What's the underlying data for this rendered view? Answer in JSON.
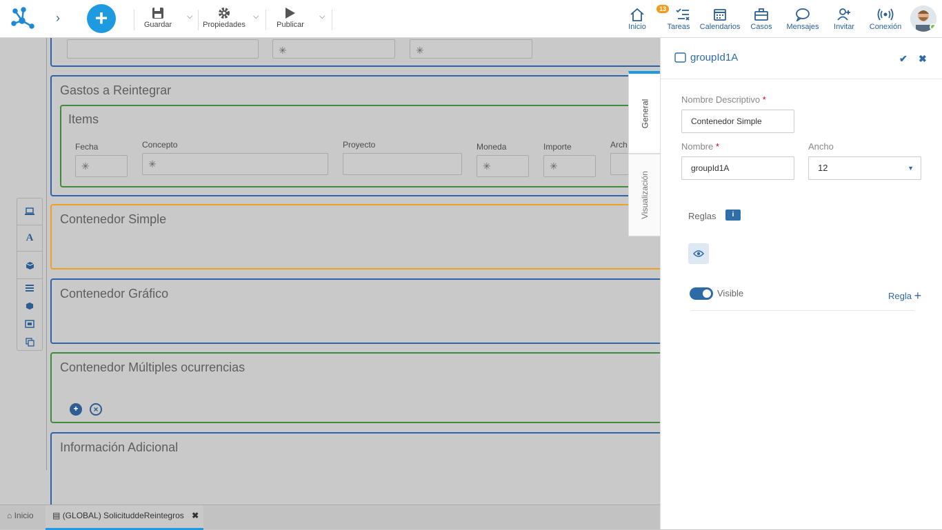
{
  "toolbar": {
    "save_label": "Guardar",
    "properties_label": "Propiedades",
    "publish_label": "Publicar"
  },
  "nav": {
    "home": "Inicio",
    "tasks": "Tareas",
    "tasks_count": "13",
    "calendars": "Calendarios",
    "cases": "Casos",
    "messages": "Mensajes",
    "invite": "Invitar",
    "connection": "Conexión"
  },
  "canvas": {
    "gastos_title": "Gastos a Reintegrar",
    "items_title": "Items",
    "items_columns": [
      "Fecha",
      "Concepto",
      "Proyecto",
      "Moneda",
      "Importe",
      "Arch"
    ],
    "contenedor_simple": "Contenedor Simple",
    "contenedor_grafico": "Contenedor Gráfico",
    "contenedor_multiples": "Contenedor Múltiples ocurrencias",
    "info_adicional": "Información Adicional"
  },
  "side_tabs": {
    "general": "General",
    "visualizacion": "Visualización"
  },
  "panel": {
    "title": "groupId1A",
    "nombre_descriptivo_label": "Nombre Descriptivo",
    "nombre_descriptivo_value": "Contenedor Simple",
    "nombre_label": "Nombre",
    "nombre_value": "groupId1A",
    "ancho_label": "Ancho",
    "ancho_value": "12",
    "reglas_label": "Reglas",
    "visible_label": "Visible",
    "visible_on": true,
    "regla_label": "Regla"
  },
  "bottom_tabs": {
    "home": "Inicio",
    "doc": "(GLOBAL) SolicituddeReintegros"
  },
  "colors": {
    "accent": "#1e9be0",
    "primary": "#2d6aa8",
    "green_border": "#3d8b3d",
    "orange_border": "#f0a020"
  }
}
